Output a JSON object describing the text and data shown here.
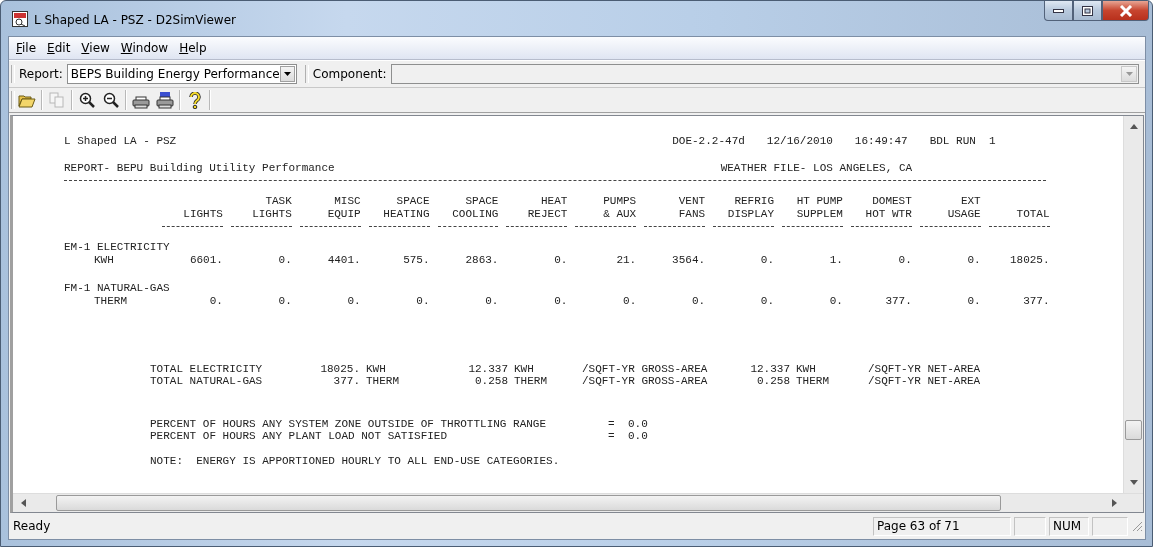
{
  "window": {
    "title": "L Shaped LA - PSZ - D2SimViewer"
  },
  "menu": [
    "File",
    "Edit",
    "View",
    "Window",
    "Help"
  ],
  "report_bar": {
    "report_label": "Report:",
    "report_value": "BEPS Building Energy Performance",
    "component_label": "Component:"
  },
  "toolbar": [
    {
      "kind": "open",
      "disabled": false
    },
    {
      "kind": "copy",
      "disabled": true
    },
    {
      "kind": "zoom-in",
      "disabled": false
    },
    {
      "kind": "zoom-out",
      "disabled": false
    },
    {
      "kind": "print",
      "disabled": false
    },
    {
      "kind": "print-page",
      "disabled": false
    },
    {
      "kind": "help",
      "disabled": false
    }
  ],
  "report": {
    "project": "L Shaped LA - PSZ",
    "header_info": [
      "DOE-2.2-47d",
      "12/16/2010",
      "16:49:47",
      "BDL RUN  1"
    ],
    "report_title": "REPORT- BEPU Building Utility Performance",
    "weather": "WEATHER FILE- LOS ANGELES, CA",
    "columns": [
      {
        "line2": "LIGHTS"
      },
      {
        "line1": "TASK",
        "line2": "LIGHTS"
      },
      {
        "line1": "MISC",
        "line2": "EQUIP"
      },
      {
        "line1": "SPACE",
        "line2": "HEATING"
      },
      {
        "line1": "SPACE",
        "line2": "COOLING"
      },
      {
        "line1": "HEAT",
        "line2": "REJECT"
      },
      {
        "line1": "PUMPS",
        "line2": "& AUX"
      },
      {
        "line1": "VENT",
        "line2": "FANS"
      },
      {
        "line1": "REFRIG",
        "line2": "DISPLAY"
      },
      {
        "line1": "HT PUMP",
        "line2": "SUPPLEM"
      },
      {
        "line1": "DOMEST",
        "line2": "HOT WTR"
      },
      {
        "line1": "EXT",
        "line2": "USAGE"
      },
      {
        "line2": "TOTAL"
      }
    ],
    "rows": [
      {
        "meter": "EM-1 ELECTRICITY",
        "unit": "KWH",
        "values": [
          "6601.",
          "0.",
          "4401.",
          "575.",
          "2863.",
          "0.",
          "21.",
          "3564.",
          "0.",
          "1.",
          "0.",
          "0.",
          "18025."
        ]
      },
      {
        "meter": "FM-1 NATURAL-GAS",
        "unit": "THERM",
        "values": [
          "0.",
          "0.",
          "0.",
          "0.",
          "0.",
          "0.",
          "0.",
          "0.",
          "0.",
          "0.",
          "377.",
          "0.",
          "377."
        ]
      }
    ],
    "totals": [
      {
        "label": "TOTAL ELECTRICITY",
        "value": "18025.",
        "unit": "KWH",
        "gross_value": "12.337",
        "gross_unit": "KWH",
        "gross_label": "/SQFT-YR GROSS-AREA",
        "net_value": "12.337",
        "net_unit": "KWH",
        "net_label": "/SQFT-YR NET-AREA"
      },
      {
        "label": "TOTAL NATURAL-GAS",
        "value": "377.",
        "unit": "THERM",
        "gross_value": "0.258",
        "gross_unit": "THERM",
        "gross_label": "/SQFT-YR GROSS-AREA",
        "net_value": "0.258",
        "net_unit": "THERM",
        "net_label": "/SQFT-YR NET-AREA"
      }
    ],
    "percents": [
      {
        "label": "PERCENT OF HOURS ANY SYSTEM ZONE OUTSIDE OF THROTTLING RANGE",
        "sign": "=",
        "value": "0.0"
      },
      {
        "label": "PERCENT OF HOURS ANY PLANT LOAD NOT SATISFIED",
        "sign": "=",
        "value": "0.0"
      }
    ],
    "note": "NOTE:  ENERGY IS APPORTIONED HOURLY TO ALL END-USE CATEGORIES."
  },
  "status_bar": {
    "message": "Ready",
    "page": "Page 63 of 71",
    "num": "NUM"
  }
}
